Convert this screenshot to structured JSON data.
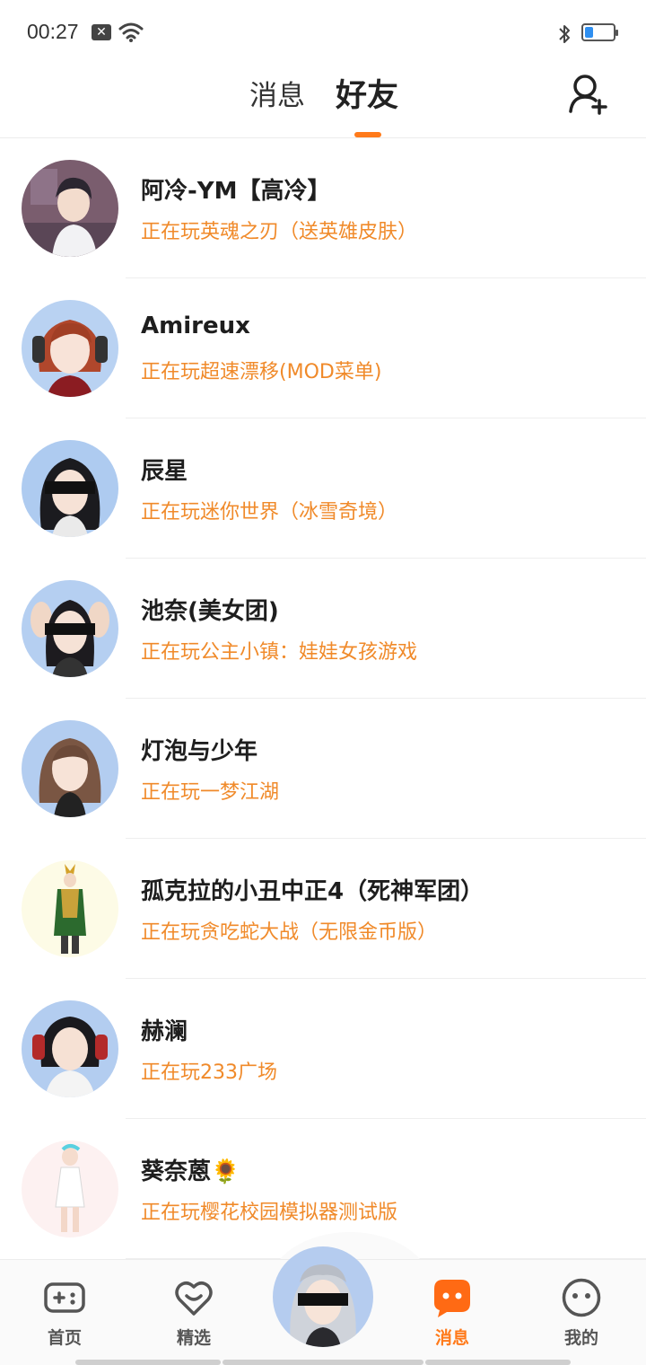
{
  "status_bar": {
    "time": "00:27",
    "battery_level": 0.3,
    "icons": [
      "notification-x-icon",
      "wifi-icon",
      "bluetooth-icon",
      "battery-icon"
    ]
  },
  "header": {
    "tabs": [
      {
        "label": "消息",
        "active": false
      },
      {
        "label": "好友",
        "active": true
      }
    ],
    "add_friend_icon": "add-friend-icon",
    "accent_color": "#ff7a1a"
  },
  "friends": [
    {
      "name": "阿冷-YM【高冷】",
      "status": "正在玩英魂之刃（送英雄皮肤）",
      "avatar_bg": "#7a5d6e"
    },
    {
      "name": "Amireux",
      "status": "正在玩超速漂移(MOD菜单)",
      "avatar_bg": "#b9d2f2"
    },
    {
      "name": "辰星",
      "status": "正在玩迷你世界（冰雪奇境）",
      "avatar_bg": "#aecbf0"
    },
    {
      "name": "池奈(美女团)",
      "status": "正在玩公主小镇：娃娃女孩游戏",
      "avatar_bg": "#b5cff1"
    },
    {
      "name": "灯泡与少年",
      "status": "正在玩一梦江湖",
      "avatar_bg": "#b3cdf0"
    },
    {
      "name": "孤克拉的小丑中正4（死神军团）",
      "status": "正在玩贪吃蛇大战（无限金币版）",
      "avatar_bg": "#fdfbe6"
    },
    {
      "name": "赫澜",
      "status": "正在玩233广场",
      "avatar_bg": "#b3cdf0"
    },
    {
      "name": "葵奈蒽🌻",
      "status": "正在玩樱花校园模拟器测试版",
      "avatar_bg": "#fdf1f1"
    }
  ],
  "bottom_nav": {
    "items": [
      {
        "label": "首页",
        "icon": "gamepad-icon"
      },
      {
        "label": "精选",
        "icon": "heart-chat-icon"
      },
      {
        "label": "消息",
        "icon": "message-bubble-icon",
        "active": true
      },
      {
        "label": "我的",
        "icon": "smiley-face-icon"
      }
    ],
    "center_icon": "avatar-center-icon"
  }
}
